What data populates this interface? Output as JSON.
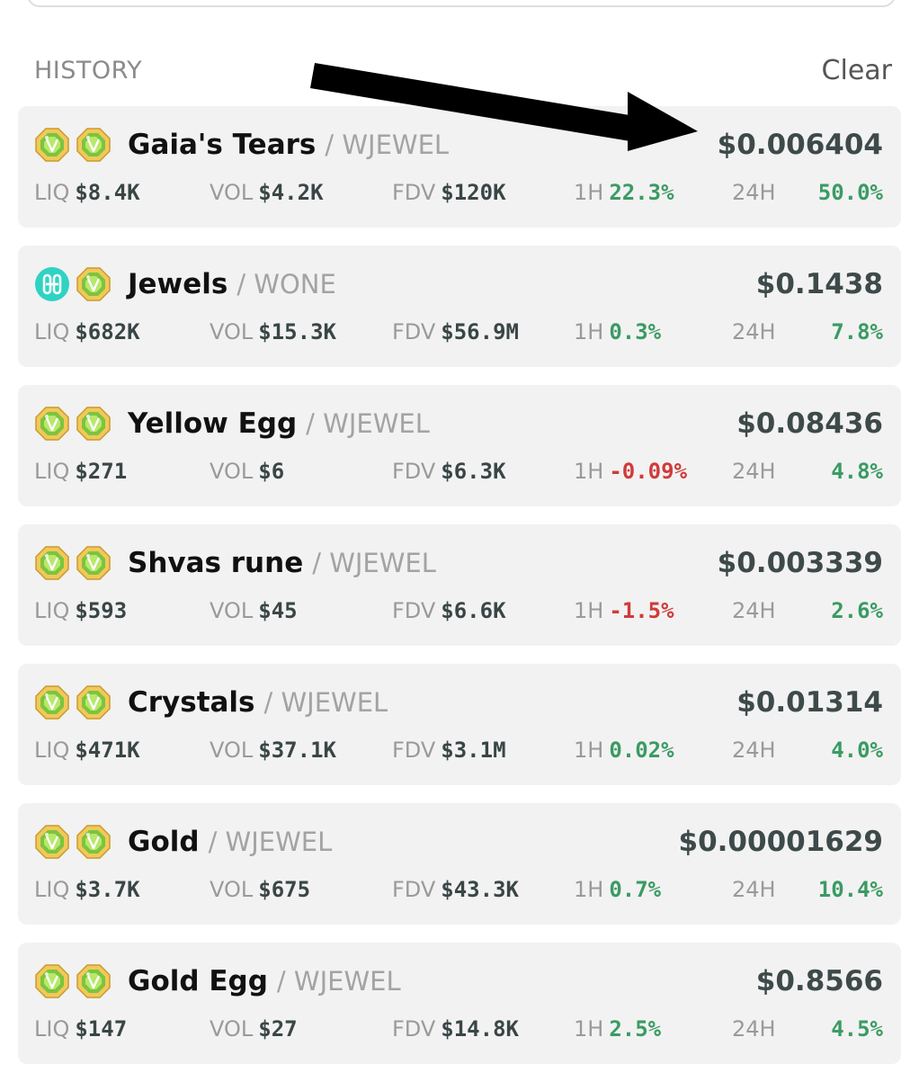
{
  "header": {
    "title": "HISTORY",
    "clear_label": "Clear"
  },
  "labels": {
    "liq": "LIQ",
    "vol": "VOL",
    "fdv": "FDV",
    "h1": "1H",
    "h24": "24H"
  },
  "colors": {
    "positive": "#3a9b63",
    "negative": "#d13a3a",
    "card_bg": "#f2f2f2"
  },
  "items": [
    {
      "name": "Gaia's Tears",
      "pair": "/ WJEWEL",
      "price": "$0.006404",
      "liq": "$8.4K",
      "vol": "$4.2K",
      "fdv": "$120K",
      "h1": "22.3%",
      "h1_trend": "pos",
      "h24": "50.0%",
      "h24_trend": "pos",
      "icons": [
        "jewel-icon",
        "jewel-icon"
      ]
    },
    {
      "name": "Jewels",
      "pair": "/ WONE",
      "price": "$0.1438",
      "liq": "$682K",
      "vol": "$15.3K",
      "fdv": "$56.9M",
      "h1": "0.3%",
      "h1_trend": "pos",
      "h24": "7.8%",
      "h24_trend": "pos",
      "icons": [
        "harmony-one-icon",
        "jewel-icon"
      ]
    },
    {
      "name": "Yellow Egg",
      "pair": "/ WJEWEL",
      "price": "$0.08436",
      "liq": "$271",
      "vol": "$6",
      "fdv": "$6.3K",
      "h1": "-0.09%",
      "h1_trend": "neg",
      "h24": "4.8%",
      "h24_trend": "pos",
      "icons": [
        "jewel-icon",
        "jewel-icon"
      ]
    },
    {
      "name": "Shvas rune",
      "pair": "/ WJEWEL",
      "price": "$0.003339",
      "liq": "$593",
      "vol": "$45",
      "fdv": "$6.6K",
      "h1": "-1.5%",
      "h1_trend": "neg",
      "h24": "2.6%",
      "h24_trend": "pos",
      "icons": [
        "jewel-icon",
        "jewel-icon"
      ]
    },
    {
      "name": "Crystals",
      "pair": "/ WJEWEL",
      "price": "$0.01314",
      "liq": "$471K",
      "vol": "$37.1K",
      "fdv": "$3.1M",
      "h1": "0.02%",
      "h1_trend": "pos",
      "h24": "4.0%",
      "h24_trend": "pos",
      "icons": [
        "jewel-icon",
        "jewel-icon"
      ]
    },
    {
      "name": "Gold",
      "pair": "/ WJEWEL",
      "price": "$0.00001629",
      "liq": "$3.7K",
      "vol": "$675",
      "fdv": "$43.3K",
      "h1": "0.7%",
      "h1_trend": "pos",
      "h24": "10.4%",
      "h24_trend": "pos",
      "icons": [
        "jewel-icon",
        "jewel-icon"
      ]
    },
    {
      "name": "Gold Egg",
      "pair": "/ WJEWEL",
      "price": "$0.8566",
      "liq": "$147",
      "vol": "$27",
      "fdv": "$14.8K",
      "h1": "2.5%",
      "h1_trend": "pos",
      "h24": "4.5%",
      "h24_trend": "pos",
      "icons": [
        "jewel-icon",
        "jewel-icon"
      ]
    }
  ]
}
